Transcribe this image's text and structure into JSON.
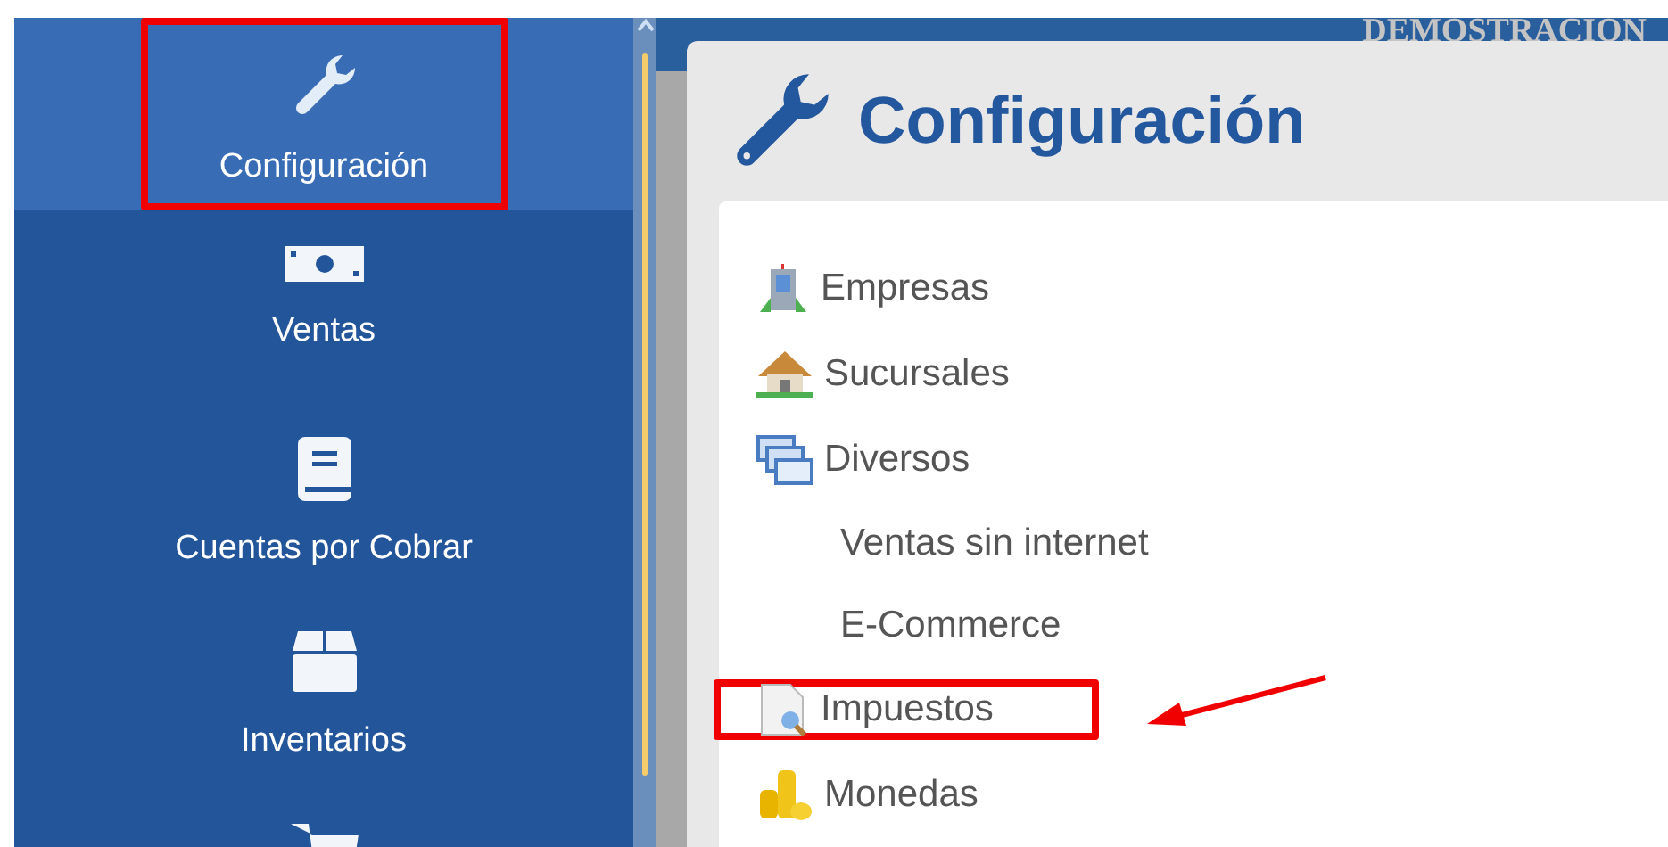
{
  "sidebar": {
    "items": [
      {
        "label": "Configuración",
        "kind": "wrench",
        "selected": true,
        "highlighted": true
      },
      {
        "label": "Ventas",
        "kind": "bill",
        "selected": false,
        "highlighted": false
      },
      {
        "label": "Cuentas por Cobrar",
        "kind": "book",
        "selected": false,
        "highlighted": false
      },
      {
        "label": "Inventarios",
        "kind": "box",
        "selected": false,
        "highlighted": false
      },
      {
        "kind": "cart",
        "selected": false
      }
    ]
  },
  "banner": "DEMOSTRACION",
  "page_title": "Configuración",
  "menu": [
    {
      "label": "Empresas",
      "kind": "building",
      "highlighted": false,
      "pointer": false
    },
    {
      "label": "Sucursales",
      "kind": "house",
      "highlighted": false,
      "pointer": false
    },
    {
      "label": "Diversos",
      "kind": "windows",
      "highlighted": false,
      "pointer": false,
      "children": [
        {
          "label": "Ventas sin internet"
        },
        {
          "label": "E-Commerce"
        }
      ]
    },
    {
      "label": "Impuestos",
      "kind": "document",
      "highlighted": true,
      "pointer": true
    },
    {
      "label": "Monedas",
      "kind": "coins",
      "highlighted": false,
      "pointer": false
    }
  ]
}
